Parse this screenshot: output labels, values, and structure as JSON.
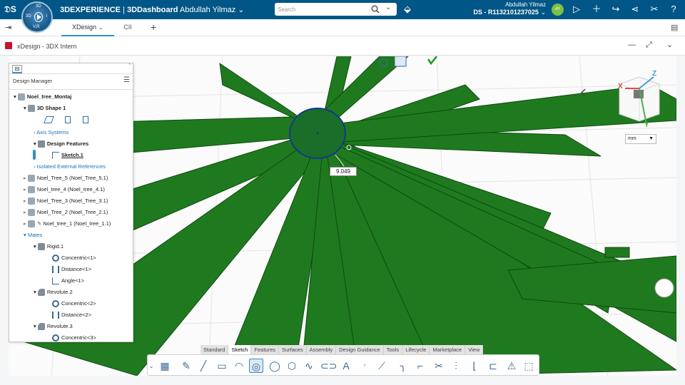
{
  "topbar": {
    "brand_bold": "3DEXPERIENCE",
    "brand_sep": " | ",
    "brand_app": "3DDashboard",
    "brand_user": "Abdullah Yilmaz",
    "search_placeholder": "Search",
    "user_name": "Abdullah Yilmaz",
    "tenant": "DS - R1132101237025",
    "avatar_initials": "AY",
    "compass_top": "3D",
    "compass_left": "3D",
    "compass_right": "i",
    "compass_bottom": "V,R",
    "icons": [
      "tag-icon",
      "add-icon",
      "share-icon",
      "network-icon",
      "tools-icon",
      "help-icon"
    ]
  },
  "tabs": [
    {
      "label": "XDesign"
    },
    {
      "label": "CII"
    }
  ],
  "app_title": "xDesign - 3DX Intern",
  "tree": {
    "header": "Design Manager",
    "items": [
      {
        "label": "Noel_tree_Montaj"
      },
      {
        "label": "3D Shape 1"
      },
      {
        "label": "Axis Systems"
      },
      {
        "label": "Design Features"
      },
      {
        "label": "Sketch.1"
      },
      {
        "label": "Isolated External References"
      },
      {
        "label": "Noel_Tree_5 (Noel_Tree_5.1)"
      },
      {
        "label": "Noel_tree_4 (Noel_tree_4.1)"
      },
      {
        "label": "Noel_Tree_3 (Noel_Tree_3.1)"
      },
      {
        "label": "Noel_Tree_2 (Noel_Tree_2.1)"
      },
      {
        "label": "Noel_tree_1 (Noel_tree_1.1)"
      },
      {
        "label": "Mates"
      },
      {
        "label": "Rigid.1"
      },
      {
        "label": "Concentric<1>"
      },
      {
        "label": "Distance<1>"
      },
      {
        "label": "Angle<1>"
      },
      {
        "label": "Revolute.2"
      },
      {
        "label": "Concentric<2>"
      },
      {
        "label": "Distance<2>"
      },
      {
        "label": "Revolute.3"
      },
      {
        "label": "Concentric<3>"
      }
    ]
  },
  "viewport": {
    "dimension_value": "9.049",
    "unit_select": "mm",
    "axis_z": "Z",
    "axis_x": "X",
    "axis_y": "Y"
  },
  "action_bar": {
    "tabs": [
      {
        "label": "Standard"
      },
      {
        "label": "Sketch"
      },
      {
        "label": "Features"
      },
      {
        "label": "Surfaces"
      },
      {
        "label": "Assembly"
      },
      {
        "label": "Design Guidance"
      },
      {
        "label": "Tools"
      },
      {
        "label": "Lifecycle"
      },
      {
        "label": "Marketplace"
      },
      {
        "label": "View"
      }
    ],
    "active_tab": "Sketch"
  },
  "colors": {
    "topbar": "#005686",
    "model_green": "#1e7a1e",
    "accent": "#368ec4"
  }
}
